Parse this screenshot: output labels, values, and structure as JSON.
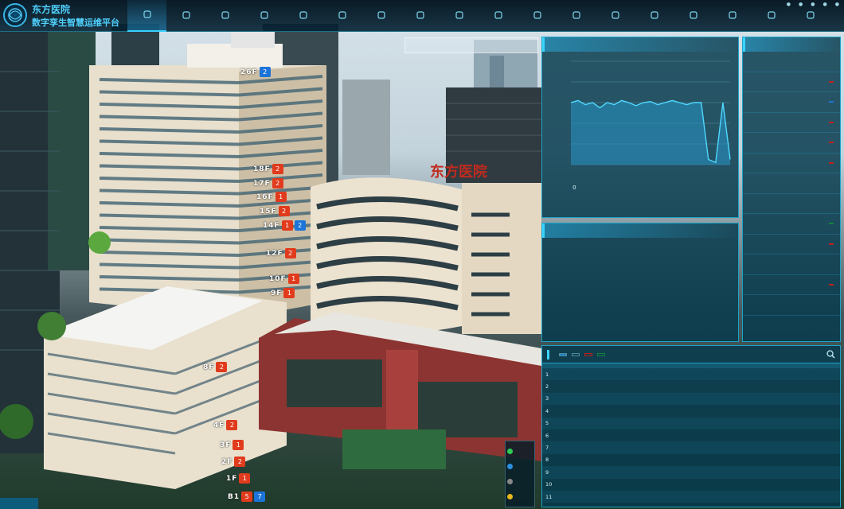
{
  "header": {
    "brand_line1": "东方医院",
    "brand_line2": "数字孪生智慧运维平台"
  },
  "nav": [
    "",
    "",
    "",
    "",
    "",
    "",
    "",
    "",
    "",
    "",
    "",
    "",
    "",
    "",
    "",
    "",
    "",
    "",
    ""
  ],
  "scene": {
    "hospital_sign": "东方医院",
    "floors": [
      {
        "label": "26F",
        "count": "2",
        "color": "blue"
      },
      {
        "label": "18F",
        "count": "2",
        "color": "red"
      },
      {
        "label": "17F",
        "count": "2",
        "color": "red"
      },
      {
        "label": "16F",
        "count": "1",
        "color": "red"
      },
      {
        "label": "15F",
        "count": "2",
        "color": "red"
      },
      {
        "label": "14F",
        "count": "1",
        "color": "red",
        "extra": "2"
      },
      {
        "label": "12F",
        "count": "2",
        "color": "red"
      },
      {
        "label": "10F",
        "count": "1",
        "color": "red"
      },
      {
        "label": "9F",
        "count": "1",
        "color": "red"
      },
      {
        "label": "8F",
        "count": "2",
        "color": "red"
      },
      {
        "label": "4F",
        "count": "2",
        "color": "red"
      },
      {
        "label": "3F",
        "count": "1",
        "color": "red"
      },
      {
        "label": "2F",
        "count": "2",
        "color": "red"
      },
      {
        "label": "1F",
        "count": "1",
        "color": "red"
      },
      {
        "label": "B1",
        "count": "5",
        "color": "red",
        "extra": "7"
      }
    ],
    "legend": [
      "",
      "",
      "",
      ""
    ]
  },
  "monitor_panel": {
    "title": "",
    "ticks": [
      "",
      "",
      "",
      "",
      "",
      "",
      "",
      ""
    ],
    "stats": [
      {
        "label": "",
        "value": "0"
      },
      {
        "label": "",
        "value": ""
      },
      {
        "label": "",
        "value": ""
      }
    ],
    "chart_data": {
      "type": "area",
      "y": [
        0.6,
        0.62,
        0.58,
        0.6,
        0.55,
        0.6,
        0.58,
        0.62,
        0.6,
        0.57,
        0.6,
        0.61,
        0.58,
        0.6,
        0.62,
        0.6,
        0.58,
        0.6,
        0.6,
        0.05,
        0.02,
        0.6,
        0.05
      ]
    }
  },
  "status_panel": {
    "title": "",
    "center_text": "",
    "stats": [
      {
        "label": "",
        "value": ""
      },
      {
        "label": "",
        "value": ""
      },
      {
        "label": "",
        "value": ""
      }
    ]
  },
  "alarm_panel": {
    "title": "",
    "items": [
      {
        "name": "",
        "badge": "",
        "type": ""
      },
      {
        "name": "",
        "badge": "",
        "type": "red"
      },
      {
        "name": "",
        "badge": "",
        "type": "blue"
      },
      {
        "name": "",
        "badge": "",
        "type": "red"
      },
      {
        "name": "",
        "badge": "",
        "type": "red"
      },
      {
        "name": "",
        "badge": "",
        "type": "red"
      },
      {
        "name": "",
        "badge": "",
        "type": ""
      },
      {
        "name": "",
        "badge": "",
        "type": ""
      },
      {
        "name": "",
        "badge": "",
        "type": "green"
      },
      {
        "name": "",
        "badge": "",
        "type": "red"
      },
      {
        "name": "",
        "badge": "",
        "type": ""
      },
      {
        "name": "",
        "badge": "",
        "type": "red"
      },
      {
        "name": "",
        "badge": "",
        "type": ""
      }
    ]
  },
  "task_panel": {
    "title": "",
    "tabs": [
      "",
      "",
      "",
      ""
    ],
    "filter": "",
    "columns": [
      "",
      "",
      "",
      "",
      "",
      ""
    ],
    "rows": [
      [
        "1",
        "",
        "",
        "",
        "",
        ""
      ],
      [
        "2",
        "",
        "",
        "",
        "",
        ""
      ],
      [
        "3",
        "",
        "",
        "",
        "",
        ""
      ],
      [
        "4",
        "",
        "",
        "",
        "",
        ""
      ],
      [
        "5",
        "",
        "",
        "",
        "",
        ""
      ],
      [
        "6",
        "",
        "",
        "",
        "",
        ""
      ],
      [
        "7",
        "",
        "",
        "",
        "",
        ""
      ],
      [
        "8",
        "",
        "",
        "",
        "",
        ""
      ],
      [
        "9",
        "",
        "",
        "",
        "",
        ""
      ],
      [
        "10",
        "",
        "",
        "",
        "",
        ""
      ],
      [
        "11",
        "",
        "",
        "",
        "",
        ""
      ]
    ]
  },
  "colors": {
    "accent": "#39d4ff",
    "panel_bg": "#063a4e",
    "alarm_red": "#c2201d",
    "alarm_blue": "#1976d2"
  },
  "corner_tag": ""
}
